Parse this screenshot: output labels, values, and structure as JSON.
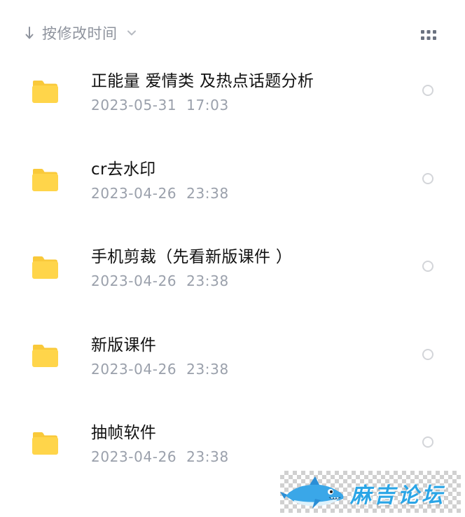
{
  "toolbar": {
    "sort_label": "按修改时间",
    "sort_icon": "arrow-down-icon",
    "dropdown_icon": "chevron-down-icon",
    "view_toggle_icon": "grid-view-icon"
  },
  "files": [
    {
      "name": "正能量 爱情类 及热点话题分析",
      "date": "2023-05-31  17:03",
      "icon": "folder-icon"
    },
    {
      "name": "cr去水印",
      "date": "2023-04-26  23:38",
      "icon": "folder-icon"
    },
    {
      "name": "手机剪裁（先看新版课件 ）",
      "date": "2023-04-26  23:38",
      "icon": "folder-icon"
    },
    {
      "name": "新版课件",
      "date": "2023-04-26  23:38",
      "icon": "folder-icon"
    },
    {
      "name": "抽帧软件",
      "date": "2023-04-26  23:38",
      "icon": "folder-icon"
    }
  ],
  "watermark": {
    "text": "麻吉论坛",
    "icon": "shark-mascot-icon"
  },
  "colors": {
    "folder": "#FFD54A",
    "folder_tab": "#F9C93A",
    "name_text": "#111111",
    "meta_text": "#9AA0AB",
    "radio_border": "#D3D5D9",
    "watermark_text": "#2AA5E6"
  }
}
